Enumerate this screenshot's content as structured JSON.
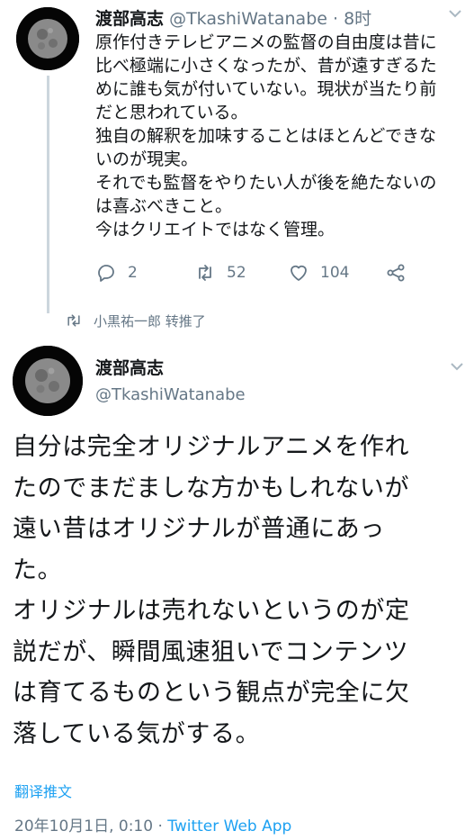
{
  "tweet1": {
    "author_name": "渡部高志",
    "handle": "@TkashiWatanabe",
    "separator": "·",
    "time": "8时",
    "lines": [
      "原作付きテレビアニメの監督の自由度は昔に",
      "比べ極端に小さくなったが、昔が遠すぎるた",
      "めに誰も気が付いていない。現状が当たり前",
      "だと思われている。",
      "独自の解釈を加味することはほとんどできな",
      "いのが現実。",
      "それでも監督をやりたい人が後を絶たないの",
      "は喜ぶべきこと。",
      "今はクリエイトではなく管理。"
    ],
    "actions": {
      "reply_count": "2",
      "retweet_count": "52",
      "like_count": "104"
    },
    "icons": {
      "reply": "reply-icon",
      "retweet": "retweet-icon",
      "like": "heart-icon",
      "share": "share-icon",
      "more": "chevron-down-icon"
    }
  },
  "retweet_banner": {
    "text": "小黒祐一郎 转推了",
    "icon": "retweet-icon"
  },
  "tweet2": {
    "author_name": "渡部高志",
    "handle": "@TkashiWatanabe",
    "lines": [
      "自分は完全オリジナルアニメを作れ",
      "たのでまだましな方かもしれないが",
      "遠い昔はオリジナルが普通にあっ",
      "た。",
      "オリジナルは売れないというのが定",
      "説だが、瞬間風速狙いでコンテンツ",
      "は育てるものという観点が完全に欠",
      "落している気がする。"
    ],
    "translate_label": "翻译推文",
    "timestamp": "20年10月1日, 0:10",
    "meta_separator": " · ",
    "app": "Twitter Web App"
  },
  "colors": {
    "text": "#14171a",
    "secondary": "#657786",
    "accent": "#1da1f2",
    "line": "#ccd6dd"
  }
}
